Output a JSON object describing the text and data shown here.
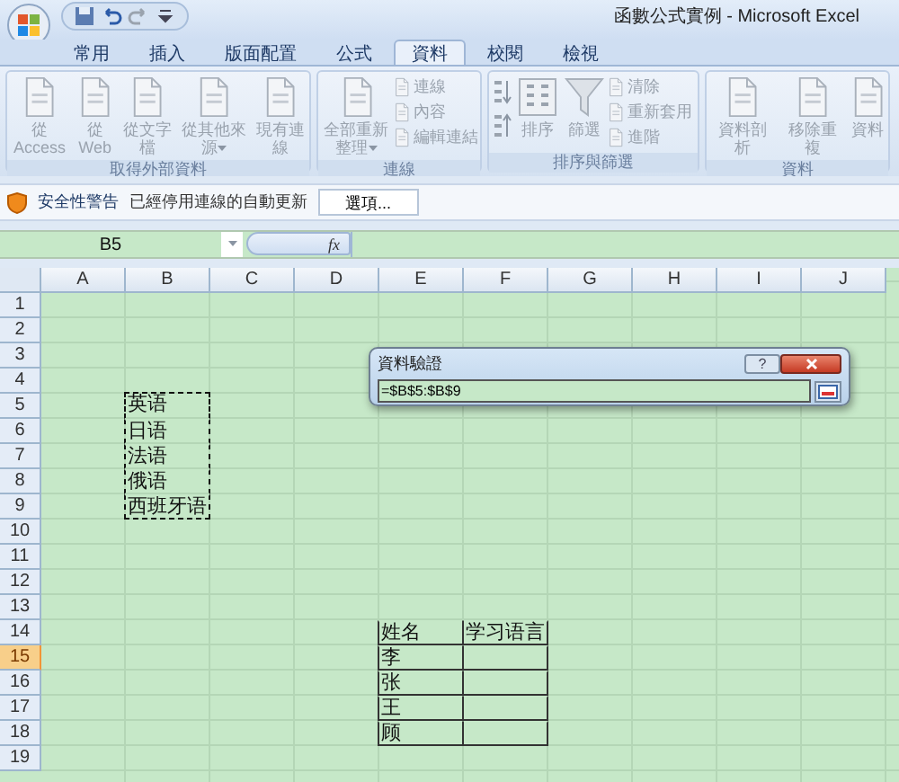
{
  "window": {
    "title": "函數公式實例 - Microsoft Excel"
  },
  "tabs": [
    {
      "label": "常用",
      "selected": false
    },
    {
      "label": "插入",
      "selected": false
    },
    {
      "label": "版面配置",
      "selected": false
    },
    {
      "label": "公式",
      "selected": false
    },
    {
      "label": "資料",
      "selected": true
    },
    {
      "label": "校閱",
      "selected": false
    },
    {
      "label": "檢視",
      "selected": false
    }
  ],
  "ribbon": {
    "groups": [
      {
        "label": "取得外部資料",
        "items": [
          {
            "kind": "large",
            "label": "從 Access"
          },
          {
            "kind": "large",
            "label": "從 Web"
          },
          {
            "kind": "large",
            "label": "從文字檔"
          },
          {
            "kind": "large",
            "label": "從其他來源",
            "dropdown": true
          },
          {
            "kind": "large",
            "label": "現有連線"
          }
        ]
      },
      {
        "label": "連線",
        "items": [
          {
            "kind": "large",
            "label": "全部重新整理",
            "dropdown": true
          },
          {
            "kind": "stack",
            "buttons": [
              {
                "label": "連線"
              },
              {
                "label": "內容"
              },
              {
                "label": "編輯連結"
              }
            ]
          }
        ]
      },
      {
        "label": "排序與篩選",
        "items": [
          {
            "kind": "sortpair"
          },
          {
            "kind": "sort",
            "label": "排序"
          },
          {
            "kind": "filter",
            "label": "篩選"
          },
          {
            "kind": "stack",
            "buttons": [
              {
                "label": "清除"
              },
              {
                "label": "重新套用"
              },
              {
                "label": "進階"
              }
            ]
          }
        ]
      },
      {
        "label": "資料",
        "items": [
          {
            "kind": "large",
            "label": "資料剖析"
          },
          {
            "kind": "large",
            "label": "移除重複"
          },
          {
            "kind": "large",
            "label": "資料"
          }
        ]
      }
    ]
  },
  "security_bar": {
    "title": "安全性警告",
    "message": "已經停用連線的自動更新",
    "button": "選項..."
  },
  "formula_bar": {
    "name_box": "B5",
    "fx": "fx"
  },
  "sheet": {
    "columns": [
      "A",
      "B",
      "C",
      "D",
      "E",
      "F",
      "G",
      "H",
      "I",
      "J"
    ],
    "rows": [
      {
        "label": "1",
        "selected": false,
        "cells": []
      },
      {
        "label": "2",
        "selected": false,
        "cells": []
      },
      {
        "label": "3",
        "selected": false,
        "cells": []
      },
      {
        "label": "4",
        "selected": false,
        "cells": []
      },
      {
        "label": "5",
        "selected": false,
        "cells": [
          {
            "text": ""
          },
          {
            "text": "英语",
            "marquee": true
          }
        ]
      },
      {
        "label": "6",
        "selected": false,
        "cells": [
          {
            "text": ""
          },
          {
            "text": "日语",
            "marquee": true
          }
        ]
      },
      {
        "label": "7",
        "selected": false,
        "cells": [
          {
            "text": ""
          },
          {
            "text": "法语",
            "marquee": true
          }
        ]
      },
      {
        "label": "8",
        "selected": false,
        "cells": [
          {
            "text": ""
          },
          {
            "text": "俄语",
            "marquee": true
          }
        ]
      },
      {
        "label": "9",
        "selected": false,
        "cells": [
          {
            "text": ""
          },
          {
            "text": "西班牙语",
            "marquee": true
          }
        ]
      },
      {
        "label": "10",
        "selected": false,
        "cells": []
      },
      {
        "label": "11",
        "selected": false,
        "cells": []
      },
      {
        "label": "12",
        "selected": false,
        "cells": []
      },
      {
        "label": "13",
        "selected": false,
        "cells": []
      },
      {
        "label": "14",
        "selected": false,
        "cells": [
          {
            "text": ""
          },
          {
            "text": ""
          },
          {
            "text": ""
          },
          {
            "text": ""
          },
          {
            "text": "姓名",
            "bordered": true
          },
          {
            "text": "学习语言",
            "bordered": true
          }
        ]
      },
      {
        "label": "15",
        "selected": true,
        "cells": [
          {
            "text": ""
          },
          {
            "text": ""
          },
          {
            "text": ""
          },
          {
            "text": ""
          },
          {
            "text": "李",
            "bordered": true
          },
          {
            "text": "",
            "bordered": true
          }
        ]
      },
      {
        "label": "16",
        "selected": false,
        "cells": [
          {
            "text": ""
          },
          {
            "text": ""
          },
          {
            "text": ""
          },
          {
            "text": ""
          },
          {
            "text": "张",
            "bordered": true
          },
          {
            "text": "",
            "bordered": true
          }
        ]
      },
      {
        "label": "17",
        "selected": false,
        "cells": [
          {
            "text": ""
          },
          {
            "text": ""
          },
          {
            "text": ""
          },
          {
            "text": ""
          },
          {
            "text": "王",
            "bordered": true
          },
          {
            "text": "",
            "bordered": true
          }
        ]
      },
      {
        "label": "18",
        "selected": false,
        "cells": [
          {
            "text": ""
          },
          {
            "text": ""
          },
          {
            "text": ""
          },
          {
            "text": ""
          },
          {
            "text": "顾",
            "bordered": true
          },
          {
            "text": "",
            "bordered": true
          }
        ]
      },
      {
        "label": "19",
        "selected": false,
        "cells": []
      }
    ]
  },
  "dialog": {
    "title": "資料驗證",
    "help": "?",
    "value": "=$B$5:$B$9"
  }
}
